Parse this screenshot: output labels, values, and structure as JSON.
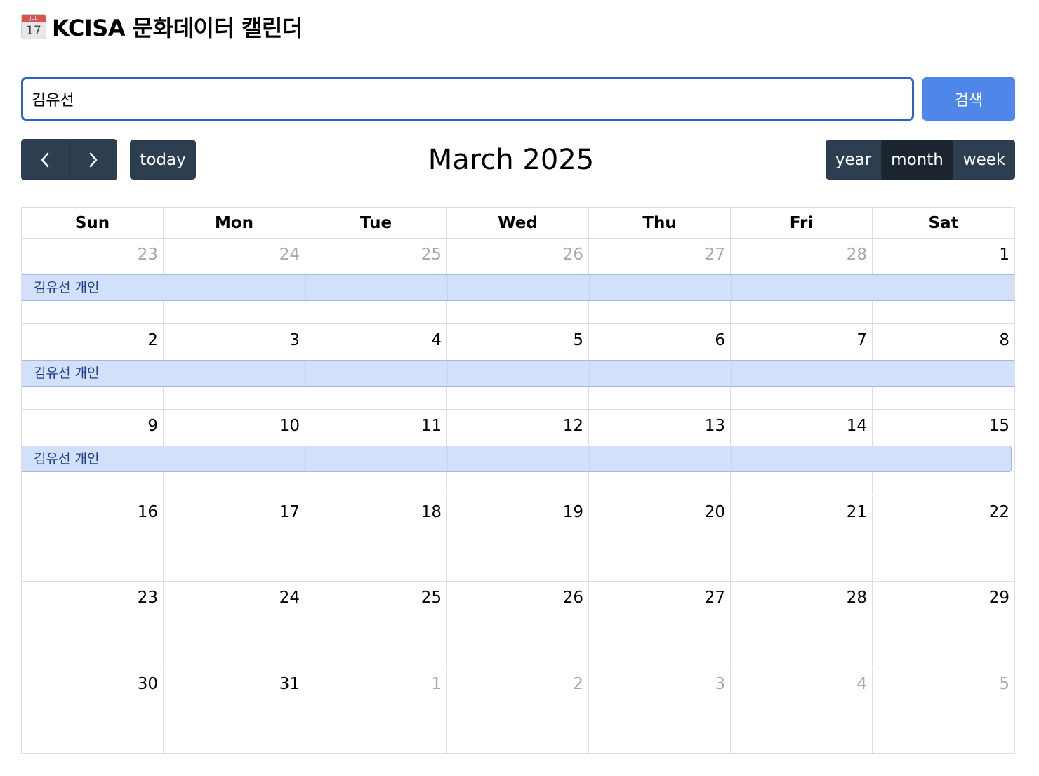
{
  "header": {
    "icon_month": "JUL",
    "icon_day": "17",
    "title": "KCISA 문화데이터 캘린더"
  },
  "search": {
    "value": "김유선",
    "button_label": "검색"
  },
  "toolbar": {
    "prev_icon": "chevron-left-icon",
    "next_icon": "chevron-right-icon",
    "today_label": "today",
    "title": "March 2025",
    "views": [
      "year",
      "month",
      "week"
    ],
    "active_view": "month"
  },
  "colors": {
    "nav_button": "#2c3e50",
    "nav_button_active": "#1a252f",
    "search_button": "#4f86ea",
    "event_bg": "#d3e0fa",
    "event_text": "#1d3f8c",
    "other_month_text": "#a8a8a8"
  },
  "calendar": {
    "weekdays": [
      "Sun",
      "Mon",
      "Tue",
      "Wed",
      "Thu",
      "Fri",
      "Sat"
    ],
    "weeks": [
      {
        "days": [
          {
            "n": "23",
            "other": true
          },
          {
            "n": "24",
            "other": true
          },
          {
            "n": "25",
            "other": true
          },
          {
            "n": "26",
            "other": true
          },
          {
            "n": "27",
            "other": true
          },
          {
            "n": "28",
            "other": true
          },
          {
            "n": "1",
            "other": false
          }
        ],
        "event": {
          "title": "김유선 개인",
          "continues": true
        }
      },
      {
        "days": [
          {
            "n": "2",
            "other": false
          },
          {
            "n": "3",
            "other": false
          },
          {
            "n": "4",
            "other": false
          },
          {
            "n": "5",
            "other": false
          },
          {
            "n": "6",
            "other": false
          },
          {
            "n": "7",
            "other": false
          },
          {
            "n": "8",
            "other": false
          }
        ],
        "event": {
          "title": "김유선 개인",
          "continues": true
        }
      },
      {
        "days": [
          {
            "n": "9",
            "other": false
          },
          {
            "n": "10",
            "other": false
          },
          {
            "n": "11",
            "other": false
          },
          {
            "n": "12",
            "other": false
          },
          {
            "n": "13",
            "other": false
          },
          {
            "n": "14",
            "other": false
          },
          {
            "n": "15",
            "other": false
          }
        ],
        "event": {
          "title": "김유선 개인",
          "continues": false
        }
      },
      {
        "days": [
          {
            "n": "16",
            "other": false
          },
          {
            "n": "17",
            "other": false
          },
          {
            "n": "18",
            "other": false
          },
          {
            "n": "19",
            "other": false
          },
          {
            "n": "20",
            "other": false
          },
          {
            "n": "21",
            "other": false
          },
          {
            "n": "22",
            "other": false
          }
        ]
      },
      {
        "days": [
          {
            "n": "23",
            "other": false
          },
          {
            "n": "24",
            "other": false
          },
          {
            "n": "25",
            "other": false
          },
          {
            "n": "26",
            "other": false
          },
          {
            "n": "27",
            "other": false
          },
          {
            "n": "28",
            "other": false
          },
          {
            "n": "29",
            "other": false
          }
        ]
      },
      {
        "days": [
          {
            "n": "30",
            "other": false
          },
          {
            "n": "31",
            "other": false
          },
          {
            "n": "1",
            "other": true
          },
          {
            "n": "2",
            "other": true
          },
          {
            "n": "3",
            "other": true
          },
          {
            "n": "4",
            "other": true
          },
          {
            "n": "5",
            "other": true
          }
        ]
      }
    ]
  }
}
